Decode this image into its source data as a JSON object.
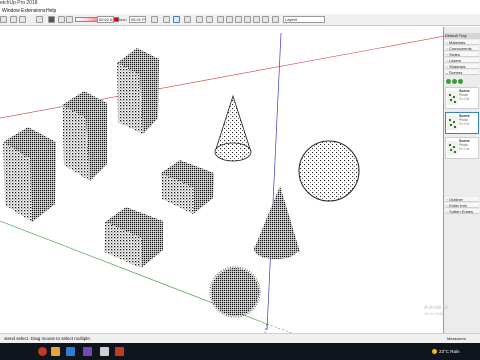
{
  "window": {
    "title": "etchUp Pro 2018"
  },
  "menu": {
    "items": [
      "Window",
      "Extensions",
      "Help"
    ]
  },
  "toolbar": {
    "field1": "00:02 AM",
    "label_noon": "Noon",
    "field2": "05:31 PM",
    "layer": "Layer0"
  },
  "tray": {
    "header": "Default Tray",
    "panels": [
      "Materials",
      "Components",
      "Styles",
      "Layers",
      "Shadows",
      "Scenes"
    ],
    "scenes": [
      {
        "name": "Scene",
        "desc": "Photo",
        "sub": "Ro Dis"
      },
      {
        "name": "Scene",
        "desc": "Photo",
        "sub": "Ro Dis"
      },
      {
        "name": "Scene",
        "desc": "Photo",
        "sub": "Ro Dis"
      }
    ],
    "bottom_panels": [
      "Outliner",
      "Entity Info",
      "Soften Edges"
    ]
  },
  "status": {
    "text": "xtend select. Drag mouse to select multiple.",
    "measurements": "Measurem"
  },
  "watermark": {
    "line1": "Activate W",
    "line2": "Go to Setti"
  },
  "taskbar": {
    "weather": "23°C Rain"
  },
  "colors": {
    "accent": "#3b82c4",
    "axis_red": "#d23a3a",
    "axis_green": "#3aa04a",
    "axis_blue": "#3a3ad2",
    "taskbar": "#10141c"
  }
}
